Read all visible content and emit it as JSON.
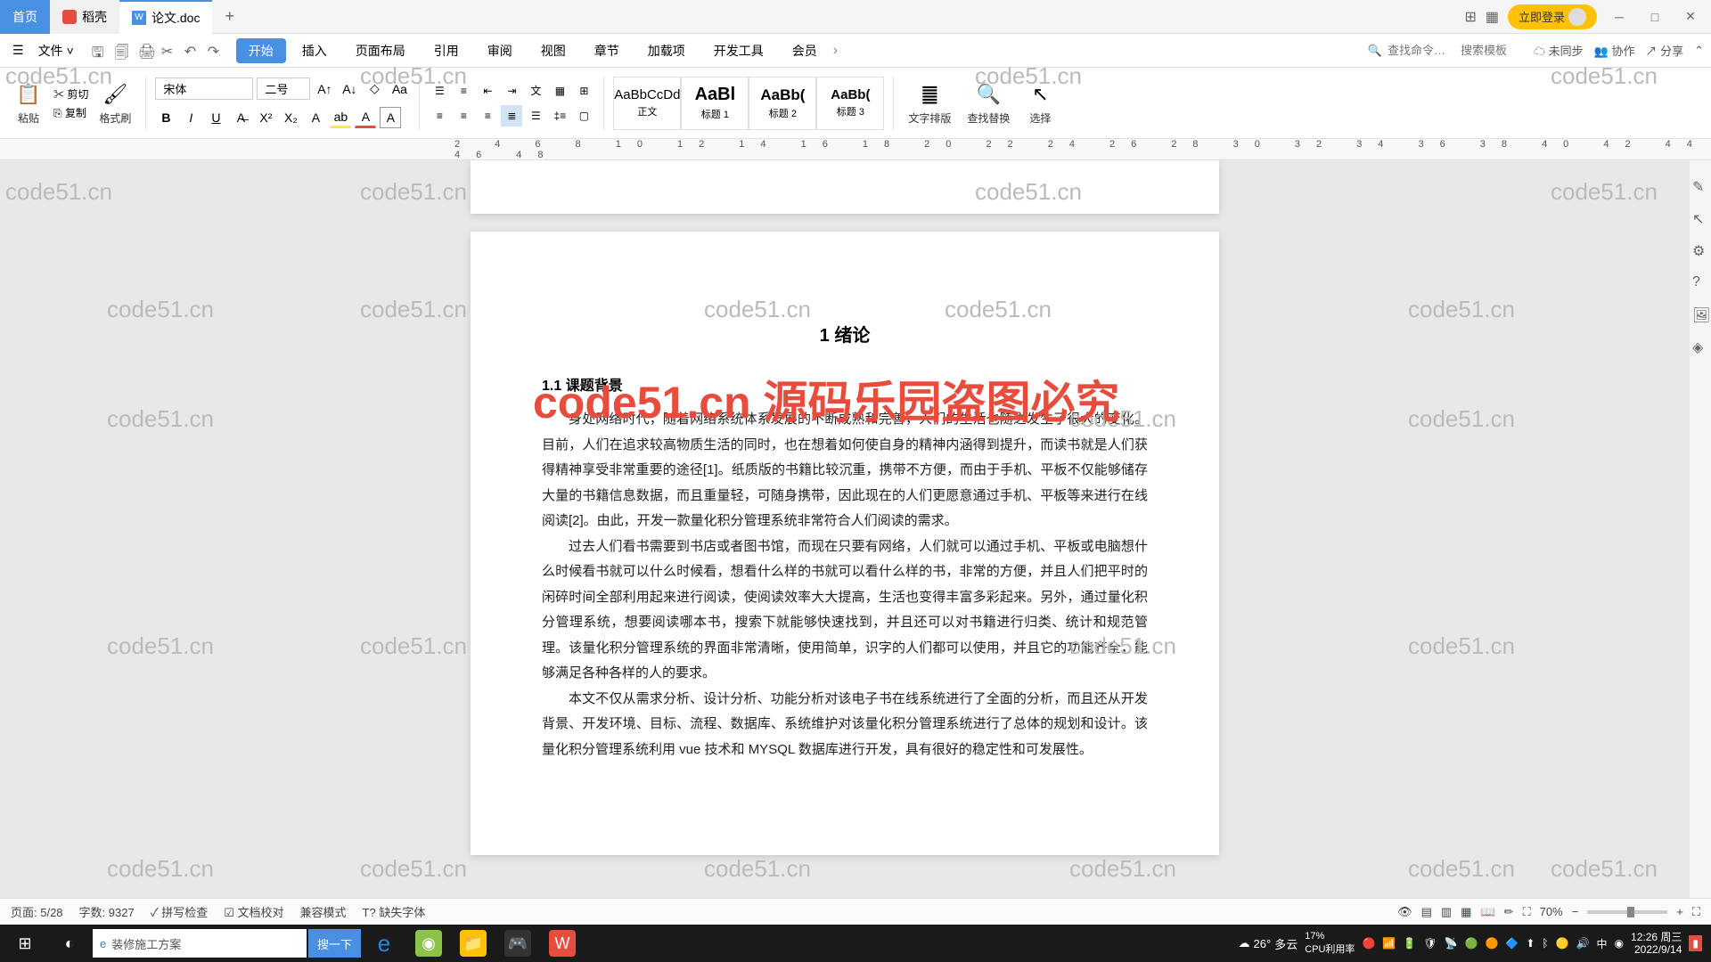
{
  "tabs": {
    "home": "首页",
    "docker": "稻壳",
    "doc": "论文.doc"
  },
  "titleRight": {
    "login": "立即登录"
  },
  "menu": {
    "file": "文件",
    "start": "开始",
    "insert": "插入",
    "pageLayout": "页面布局",
    "reference": "引用",
    "review": "审阅",
    "view": "视图",
    "chapter": "章节",
    "addon": "加载项",
    "devtools": "开发工具",
    "member": "会员"
  },
  "menuRight": {
    "searchPh": "查找命令…",
    "templatePh": "搜索模板",
    "unsync": "未同步",
    "collab": "协作",
    "share": "分享"
  },
  "ribbon": {
    "paste": "粘贴",
    "cut": "剪切",
    "copy": "复制",
    "formatPainter": "格式刷",
    "fontName": "宋体",
    "fontSize": "二号",
    "styles": [
      {
        "preview": "AaBbCcDd",
        "name": "正文"
      },
      {
        "preview": "AaBl",
        "name": "标题 1"
      },
      {
        "preview": "AaBb(",
        "name": "标题 2"
      },
      {
        "preview": "AaBb(",
        "name": "标题 3"
      }
    ],
    "textLayout": "文字排版",
    "findReplace": "查找替换",
    "select": "选择"
  },
  "ruler": "2 4 6 8 10 12 14 16 18 20 22 24 26 28 30 32 34 36 38 40 42 44 46 48",
  "doc": {
    "chapterTitle": "1 绪论",
    "section1": "1.1 课题背景",
    "p1": "身处网络时代，随着网络系统体系发展的不断成熟和完善，人们的生活也随之发生了很大的变化。目前，人们在追求较高物质生活的同时，也在想着如何使自身的精神内涵得到提升，而读书就是人们获得精神享受非常重要的途径[1]。纸质版的书籍比较沉重，携带不方便，而由于手机、平板不仅能够储存大量的书籍信息数据，而且重量轻，可随身携带，因此现在的人们更愿意通过手机、平板等来进行在线阅读[2]。由此，开发一款量化积分管理系统非常符合人们阅读的需求。",
    "p2": "过去人们看书需要到书店或者图书馆，而现在只要有网络，人们就可以通过手机、平板或电脑想什么时候看书就可以什么时候看，想看什么样的书就可以看什么样的书，非常的方便，并且人们把平时的闲碎时间全部利用起来进行阅读，使阅读效率大大提高，生活也变得丰富多彩起来。另外，通过量化积分管理系统，想要阅读哪本书，搜索下就能够快速找到，并且还可以对书籍进行归类、统计和规范管理。该量化积分管理系统的界面非常清晰，使用简单，识字的人们都可以使用，并且它的功能齐全，能够满足各种各样的人的要求。",
    "p3": "本文不仅从需求分析、设计分析、功能分析对该电子书在线系统进行了全面的分析，而且还从开发背景、开发环境、目标、流程、数据库、系统维护对该量化积分管理系统进行了总体的规划和设计。该量化积分管理系统利用 vue 技术和 MYSQL 数据库进行开发，具有很好的稳定性和可发展性。"
  },
  "redWm": "code51.cn   源码乐园盗图必究",
  "wm": "code51.cn",
  "status": {
    "page": "页面: 5/28",
    "words": "字数: 9327",
    "spell": "拼写检查",
    "proof": "文档校对",
    "compat": "兼容模式",
    "missing": "缺失字体",
    "zoom": "70%"
  },
  "taskbar": {
    "searchText": "装修施工方案",
    "searchBtn": "搜一下",
    "weatherTemp": "26°",
    "weatherCond": "多云",
    "cpu": "CPU利用率",
    "pct": "17%",
    "time": "12:26 周三",
    "date": "2022/9/14"
  }
}
